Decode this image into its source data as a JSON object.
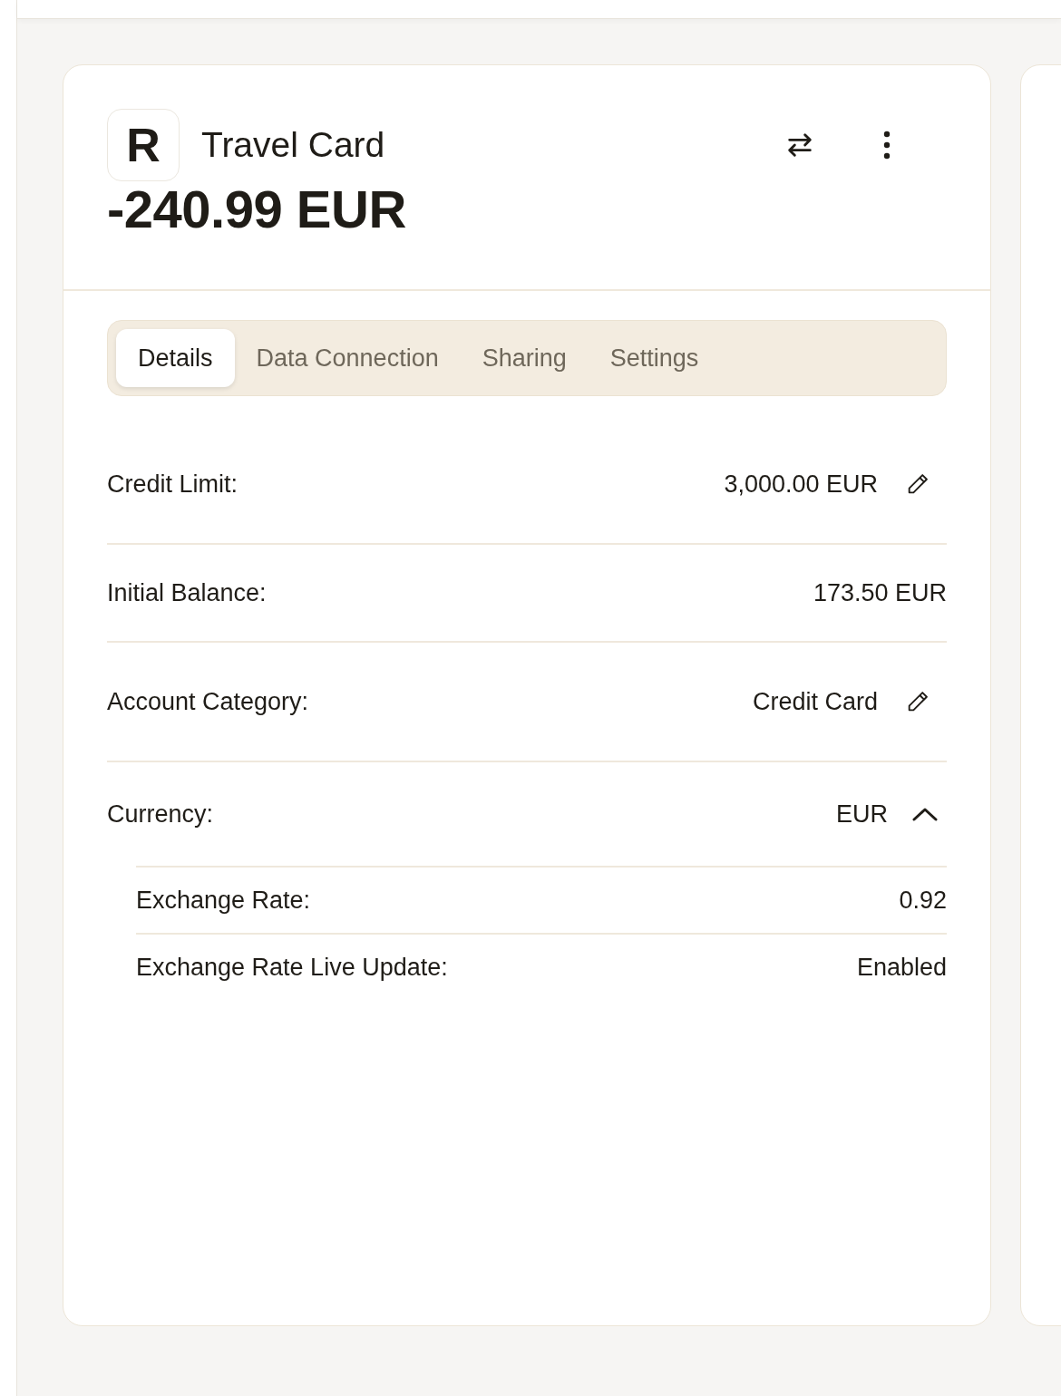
{
  "account": {
    "name": "Travel Card",
    "balance": "-240.99 EUR",
    "logo": "R"
  },
  "tabs": [
    {
      "label": "Details",
      "selected": true
    },
    {
      "label": "Data Connection",
      "selected": false
    },
    {
      "label": "Sharing",
      "selected": false
    },
    {
      "label": "Settings",
      "selected": false
    }
  ],
  "details": [
    {
      "kind": "editable",
      "label": "Credit Limit:",
      "value": "3,000.00 EUR"
    },
    {
      "kind": "plain",
      "label": "Initial Balance:",
      "value": "173.50 EUR"
    },
    {
      "kind": "editable",
      "label": "Account Category:",
      "value": "Credit Card"
    },
    {
      "kind": "expandable",
      "label": "Currency:",
      "value": "EUR",
      "expanded": true,
      "children": [
        {
          "label": "Exchange Rate:",
          "value": "0.92"
        },
        {
          "label": "Exchange Rate Live Update:",
          "value": "Enabled"
        }
      ]
    }
  ]
}
